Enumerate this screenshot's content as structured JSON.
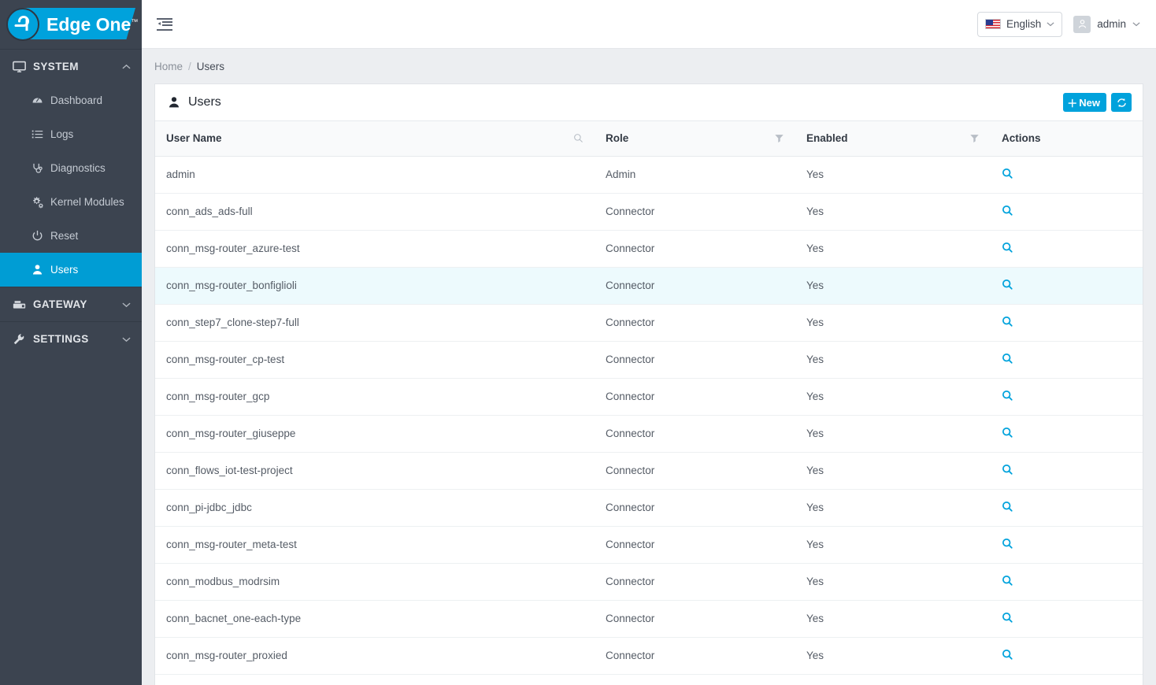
{
  "brand": {
    "logo_text": "e1",
    "name": "Edge One",
    "tm": "™"
  },
  "sidebar": {
    "sections": [
      {
        "label": "SYSTEM",
        "icon": "monitor-icon",
        "expanded": true,
        "chevron": "⌃",
        "items": [
          {
            "label": "Dashboard",
            "icon": "dashboard-icon",
            "active": false
          },
          {
            "label": "Logs",
            "icon": "list-icon",
            "active": false
          },
          {
            "label": "Diagnostics",
            "icon": "stethoscope-icon",
            "active": false
          },
          {
            "label": "Kernel Modules",
            "icon": "cogs-icon",
            "active": false
          },
          {
            "label": "Reset",
            "icon": "power-icon",
            "active": false
          },
          {
            "label": "Users",
            "icon": "user-icon",
            "active": true
          }
        ]
      },
      {
        "label": "GATEWAY",
        "icon": "server-icon",
        "expanded": false,
        "chevron": "⌄",
        "items": []
      },
      {
        "label": "SETTINGS",
        "icon": "wrench-icon",
        "expanded": false,
        "chevron": "⌄",
        "items": []
      }
    ]
  },
  "topbar": {
    "collapse_icon": "indent-collapse-icon",
    "language": {
      "label": "English",
      "flag": "us-flag-icon",
      "caret": "⌄"
    },
    "user": {
      "label": "admin",
      "avatar_icon": "user-avatar-icon",
      "caret": "⌄"
    }
  },
  "breadcrumb": {
    "home": "Home",
    "separator": "/",
    "current": "Users"
  },
  "card": {
    "title": "Users",
    "title_icon": "user-icon",
    "new_button": {
      "label": "New",
      "plus": "＋"
    },
    "refresh_button": {
      "icon": "refresh-icon"
    }
  },
  "table": {
    "columns": [
      {
        "key": "user_name",
        "label": "User Name",
        "tool": "search-icon"
      },
      {
        "key": "role",
        "label": "Role",
        "tool": "filter-icon"
      },
      {
        "key": "enabled",
        "label": "Enabled",
        "tool": "filter-icon"
      },
      {
        "key": "actions",
        "label": "Actions",
        "tool": ""
      }
    ],
    "rows": [
      {
        "user_name": "admin",
        "role": "Admin",
        "enabled": "Yes",
        "action": "view-icon",
        "highlight": false
      },
      {
        "user_name": "conn_ads_ads-full",
        "role": "Connector",
        "enabled": "Yes",
        "action": "view-icon",
        "highlight": false
      },
      {
        "user_name": "conn_msg-router_azure-test",
        "role": "Connector",
        "enabled": "Yes",
        "action": "view-icon",
        "highlight": false
      },
      {
        "user_name": "conn_msg-router_bonfiglioli",
        "role": "Connector",
        "enabled": "Yes",
        "action": "view-icon",
        "highlight": true
      },
      {
        "user_name": "conn_step7_clone-step7-full",
        "role": "Connector",
        "enabled": "Yes",
        "action": "view-icon",
        "highlight": false
      },
      {
        "user_name": "conn_msg-router_cp-test",
        "role": "Connector",
        "enabled": "Yes",
        "action": "view-icon",
        "highlight": false
      },
      {
        "user_name": "conn_msg-router_gcp",
        "role": "Connector",
        "enabled": "Yes",
        "action": "view-icon",
        "highlight": false
      },
      {
        "user_name": "conn_msg-router_giuseppe",
        "role": "Connector",
        "enabled": "Yes",
        "action": "view-icon",
        "highlight": false
      },
      {
        "user_name": "conn_flows_iot-test-project",
        "role": "Connector",
        "enabled": "Yes",
        "action": "view-icon",
        "highlight": false
      },
      {
        "user_name": "conn_pi-jdbc_jdbc",
        "role": "Connector",
        "enabled": "Yes",
        "action": "view-icon",
        "highlight": false
      },
      {
        "user_name": "conn_msg-router_meta-test",
        "role": "Connector",
        "enabled": "Yes",
        "action": "view-icon",
        "highlight": false
      },
      {
        "user_name": "conn_modbus_modrsim",
        "role": "Connector",
        "enabled": "Yes",
        "action": "view-icon",
        "highlight": false
      },
      {
        "user_name": "conn_bacnet_one-each-type",
        "role": "Connector",
        "enabled": "Yes",
        "action": "view-icon",
        "highlight": false
      },
      {
        "user_name": "conn_msg-router_proxied",
        "role": "Connector",
        "enabled": "Yes",
        "action": "view-icon",
        "highlight": false
      }
    ]
  },
  "colors": {
    "accent": "#00a2dc",
    "sidebar_bg": "#3c4450",
    "page_bg": "#eceef1",
    "row_highlight": "#edfafd"
  }
}
